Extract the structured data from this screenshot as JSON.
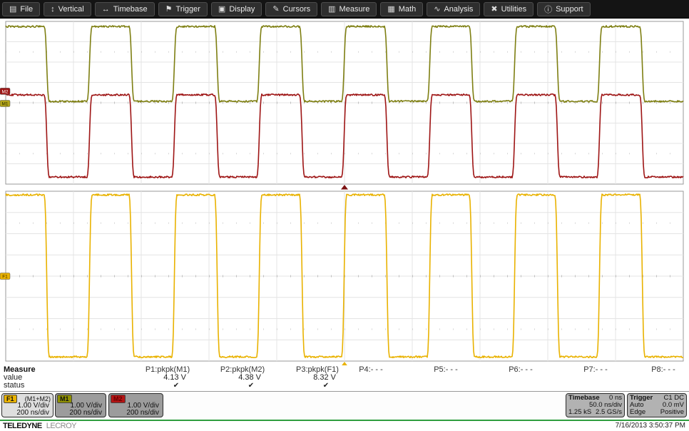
{
  "menubar": {
    "items": [
      {
        "label": "File",
        "icon": "▤"
      },
      {
        "label": "Vertical",
        "icon": "↕"
      },
      {
        "label": "Timebase",
        "icon": "↔"
      },
      {
        "label": "Trigger",
        "icon": "⚑"
      },
      {
        "label": "Display",
        "icon": "▣"
      },
      {
        "label": "Cursors",
        "icon": "✎"
      },
      {
        "label": "Measure",
        "icon": "▥"
      },
      {
        "label": "Math",
        "icon": "▦"
      },
      {
        "label": "Analysis",
        "icon": "∿"
      },
      {
        "label": "Utilities",
        "icon": "✖"
      },
      {
        "label": "Support",
        "icon": "ⓘ"
      }
    ]
  },
  "chart_data": {
    "type": "line",
    "title": "Dual-grid oscilloscope capture: square waves M1, M2 and F1 = M1+M2",
    "x": {
      "units": "ns",
      "range": [
        -1000,
        1000
      ],
      "ns_per_div": 200,
      "divisions": 10
    },
    "y": {
      "volts_per_div": 1.0,
      "divisions_per_grid": 8
    },
    "waveform": {
      "period_ns": 251,
      "duty_cycle": 0.5,
      "rising_edge_at_ns": 0,
      "phase": "all three traces in phase"
    },
    "series": [
      {
        "name": "M1",
        "grid": "top",
        "color": "#7e7f12",
        "high_div": 3.75,
        "low_div": 0.07,
        "pkpk_v": 4.13,
        "marker_label": "M1",
        "marker_bg": "#b3a419",
        "marker_fg": "#2a2a00"
      },
      {
        "name": "M2",
        "grid": "top",
        "color": "#9e1515",
        "high_div": 0.39,
        "low_div": -3.65,
        "pkpk_v": 4.38,
        "marker_label": "M2",
        "marker_bg": "#9e1515",
        "marker_fg": "#ffffff"
      },
      {
        "name": "F1",
        "grid": "bottom",
        "color": "#e9b200",
        "high_div": 3.83,
        "low_div": -3.8,
        "pkpk_v": 8.32,
        "marker_label": "F1",
        "marker_bg": "#e9b200",
        "marker_fg": "#3a2a00"
      }
    ],
    "trigger_markers": [
      {
        "grid": "top",
        "color": "#7c1212",
        "position_ns": 0
      },
      {
        "grid": "bottom",
        "color": "#e9b200",
        "position_ns": 0
      }
    ],
    "grid_style": {
      "line_color": "#e4e4e4",
      "border_color": "#9a9a9a",
      "tick_color": "#b5b5b5",
      "background": "#ffffff"
    }
  },
  "measure_panel": {
    "row_labels": {
      "measure": "Measure",
      "value": "value",
      "status": "status"
    },
    "params": [
      {
        "id": "P1",
        "label": "P1:pkpk(M1)",
        "value": "4.13 V",
        "status": "✔"
      },
      {
        "id": "P2",
        "label": "P2:pkpk(M2)",
        "value": "4.38 V",
        "status": "✔"
      },
      {
        "id": "P3",
        "label": "P3:pkpk(F1)",
        "value": "8.32 V",
        "status": "✔"
      },
      {
        "id": "P4",
        "label": "P4:- - -",
        "value": "",
        "status": ""
      },
      {
        "id": "P5",
        "label": "P5:- - -",
        "value": "",
        "status": ""
      },
      {
        "id": "P6",
        "label": "P6:- - -",
        "value": "",
        "status": ""
      },
      {
        "id": "P7",
        "label": "P7:- - -",
        "value": "",
        "status": ""
      },
      {
        "id": "P8",
        "label": "P8:- - -",
        "value": "",
        "status": ""
      }
    ]
  },
  "descriptors": {
    "f1": {
      "tag": "F1",
      "tag_bg": "#e9b200",
      "source": "(M1+M2)",
      "volts": "1.00 V/div",
      "time": "200 ns/div"
    },
    "m1": {
      "tag": "M1",
      "tag_bg": "#8f9000",
      "volts": "1.00 V/div",
      "time": "200 ns/div"
    },
    "m2": {
      "tag": "M2",
      "tag_bg": "#b31414",
      "volts": "1.00 V/div",
      "time": "200 ns/div"
    }
  },
  "timebase_box": {
    "title": "Timebase",
    "offset": "0 ns",
    "scale": "50.0 ns/div",
    "samples": "1.25 kS",
    "rate": "2.5 GS/s"
  },
  "trigger_box": {
    "title": "Trigger",
    "source": "C1 DC",
    "mode": "Auto",
    "level": "0.0 mV",
    "coupling": "Edge",
    "slope": "Positive"
  },
  "status_bar": {
    "brand_primary": "TELEDYNE",
    "brand_secondary": "LECROY",
    "datetime": "7/16/2013 3:50:37 PM"
  }
}
